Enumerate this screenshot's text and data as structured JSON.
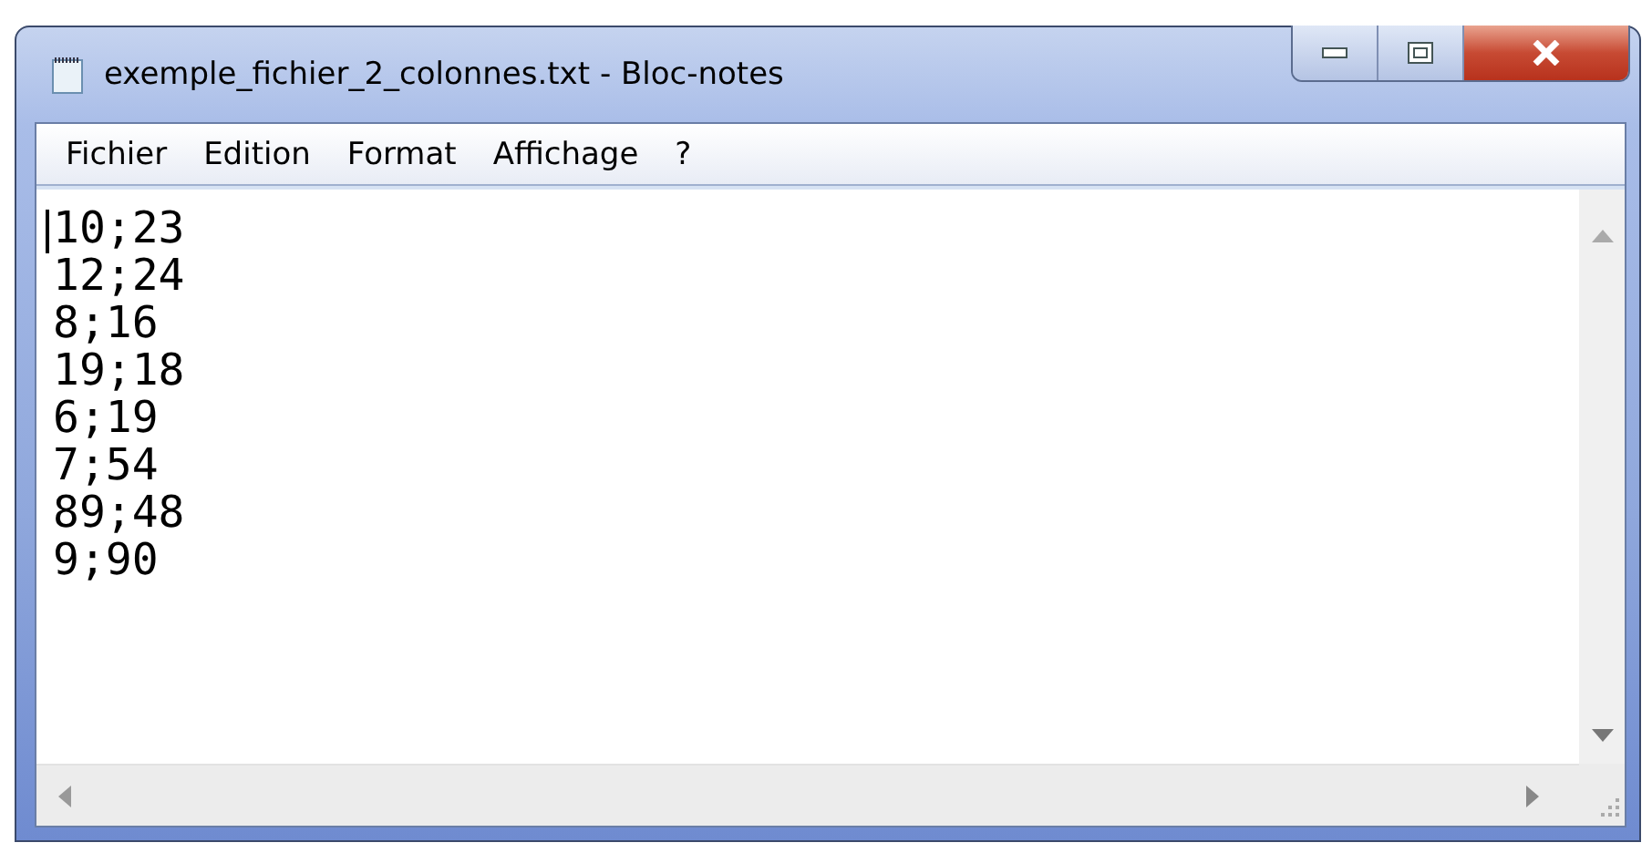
{
  "window": {
    "title": "exemple_fichier_2_colonnes.txt - Bloc-notes"
  },
  "menu": [
    {
      "label": "Fichier"
    },
    {
      "label": "Edition"
    },
    {
      "label": "Format"
    },
    {
      "label": "Affichage"
    },
    {
      "label": "?"
    }
  ],
  "editor": {
    "lines": [
      "10;23",
      "12;24",
      "8;16",
      "19;18",
      "6;19",
      "7;54",
      "89;48",
      "9;90"
    ]
  }
}
